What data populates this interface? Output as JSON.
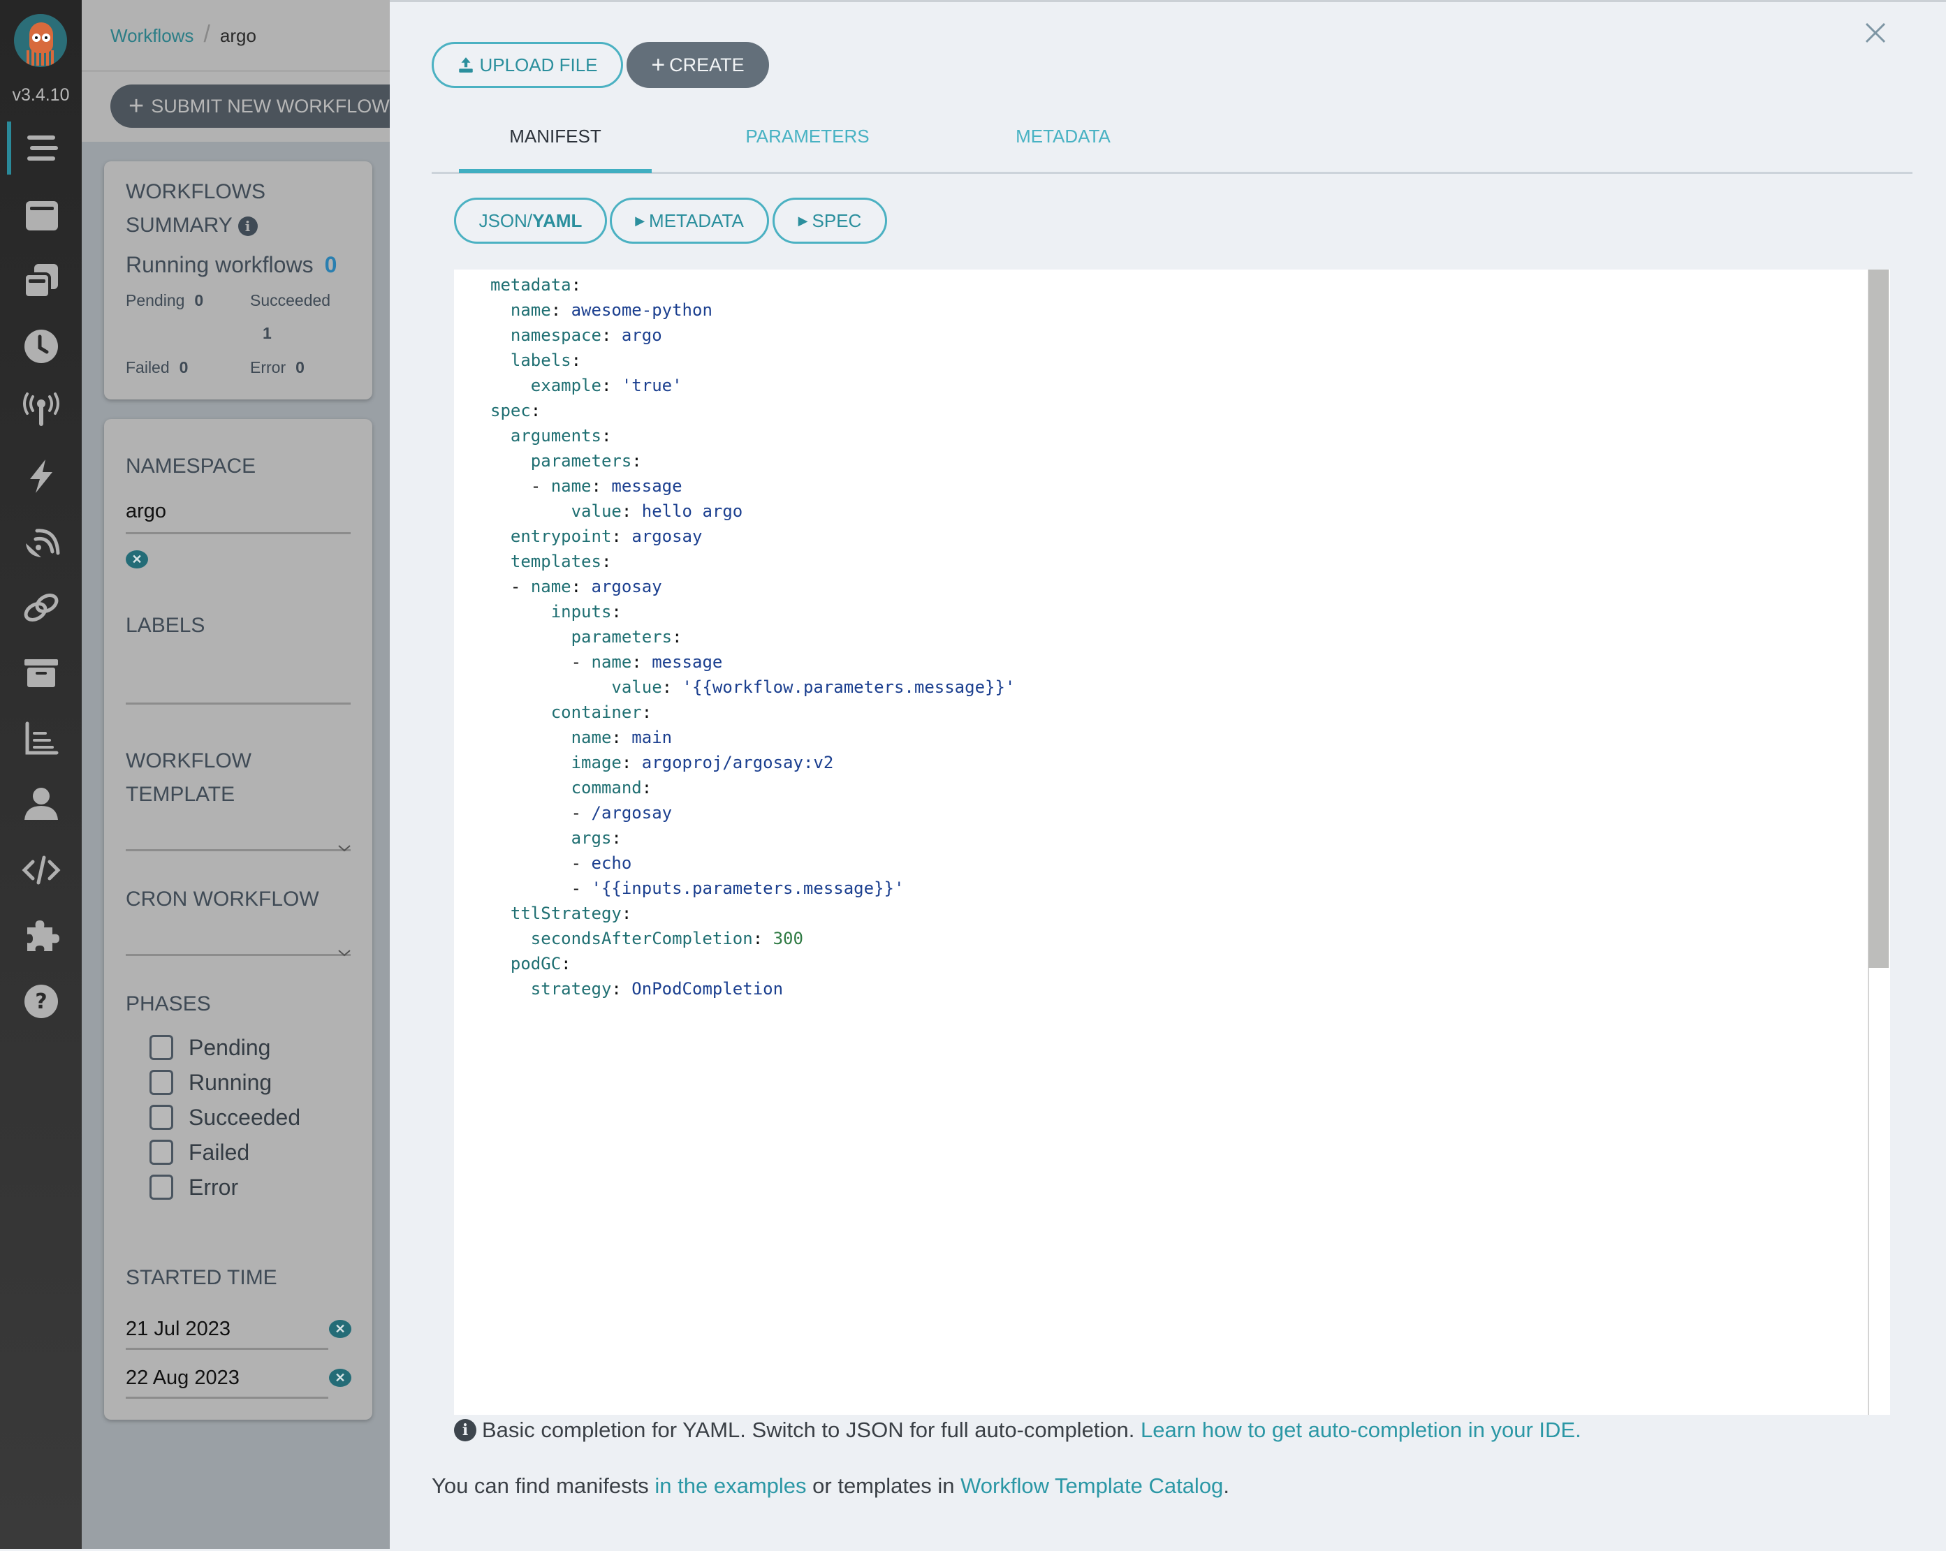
{
  "nav": {
    "version": "v3.4.10",
    "items": [
      {
        "icon": "menu-icon",
        "active": true
      },
      {
        "icon": "workflow-templates-icon"
      },
      {
        "icon": "cluster-workflow-templates-icon"
      },
      {
        "icon": "cron-workflows-icon"
      },
      {
        "icon": "event-sources-icon"
      },
      {
        "icon": "sensors-icon"
      },
      {
        "icon": "event-flow-icon"
      },
      {
        "icon": "link-icon"
      },
      {
        "icon": "archived-workflows-icon"
      },
      {
        "icon": "reports-icon"
      },
      {
        "icon": "user-icon"
      },
      {
        "icon": "api-docs-icon"
      },
      {
        "icon": "plugins-icon"
      },
      {
        "icon": "help-icon"
      }
    ]
  },
  "breadcrumb": {
    "root": "Workflows",
    "separator": "/",
    "current": "argo"
  },
  "toolbar": {
    "submit_label": "SUBMIT NEW WORKFLOW"
  },
  "summary": {
    "title_line1": "WORKFLOWS",
    "title_line2": "SUMMARY",
    "running_label": "Running workflows",
    "running_count": "0",
    "pending_label": "Pending",
    "pending_count": "0",
    "succeeded_label": "Succeeded",
    "succeeded_count": "1",
    "failed_label": "Failed",
    "failed_count": "0",
    "error_label": "Error",
    "error_count": "0"
  },
  "filters": {
    "namespace_label": "NAMESPACE",
    "namespace_value": "argo",
    "labels_label": "LABELS",
    "labels_value": "",
    "workflow_template_line1": "WORKFLOW",
    "workflow_template_line2": "TEMPLATE",
    "workflow_template_value": "",
    "cron_workflow_label": "CRON WORKFLOW",
    "cron_workflow_value": "",
    "phases_label": "PHASES",
    "phases": [
      {
        "label": "Pending",
        "checked": false
      },
      {
        "label": "Running",
        "checked": false
      },
      {
        "label": "Succeeded",
        "checked": false
      },
      {
        "label": "Failed",
        "checked": false
      },
      {
        "label": "Error",
        "checked": false
      }
    ],
    "started_time_label": "STARTED TIME",
    "started_from": "21 Jul 2023",
    "started_to": "22 Aug 2023"
  },
  "panel": {
    "upload_label": "UPLOAD FILE",
    "create_label": "CREATE",
    "tabs": [
      {
        "label": "MANIFEST",
        "active": true
      },
      {
        "label": "PARAMETERS"
      },
      {
        "label": "METADATA"
      }
    ],
    "sub_buttons": {
      "format_prefix": "JSON/",
      "format_active": "YAML",
      "metadata": "METADATA",
      "spec": "SPEC"
    },
    "editor_lines": [
      {
        "indent": 0,
        "key": "metadata",
        "value": ""
      },
      {
        "indent": 1,
        "key": "name",
        "value": "awesome-python"
      },
      {
        "indent": 1,
        "key": "namespace",
        "value": "argo"
      },
      {
        "indent": 1,
        "key": "labels",
        "value": ""
      },
      {
        "indent": 2,
        "key": "example",
        "value": "'true'"
      },
      {
        "indent": 0,
        "key": "spec",
        "value": ""
      },
      {
        "indent": 1,
        "key": "arguments",
        "value": ""
      },
      {
        "indent": 2,
        "key": "parameters",
        "value": ""
      },
      {
        "indent": 3,
        "dash": true,
        "key": "name",
        "value": "message"
      },
      {
        "indent": 4,
        "key": "value",
        "value": "hello argo"
      },
      {
        "indent": 1,
        "key": "entrypoint",
        "value": "argosay"
      },
      {
        "indent": 1,
        "key": "templates",
        "value": ""
      },
      {
        "indent": 2,
        "dash": true,
        "key": "name",
        "value": "argosay"
      },
      {
        "indent": 3,
        "key": "inputs",
        "value": ""
      },
      {
        "indent": 4,
        "key": "parameters",
        "value": ""
      },
      {
        "indent": 5,
        "dash": true,
        "key": "name",
        "value": "message"
      },
      {
        "indent": 6,
        "key": "value",
        "value": "'{{workflow.parameters.message}}'"
      },
      {
        "indent": 3,
        "key": "container",
        "value": ""
      },
      {
        "indent": 4,
        "key": "name",
        "value": "main"
      },
      {
        "indent": 4,
        "key": "image",
        "value": "argoproj/argosay:v2"
      },
      {
        "indent": 4,
        "key": "command",
        "value": ""
      },
      {
        "indent": 5,
        "dash": true,
        "key": "",
        "value": "/argosay"
      },
      {
        "indent": 4,
        "key": "args",
        "value": ""
      },
      {
        "indent": 5,
        "dash": true,
        "key": "",
        "value": "echo"
      },
      {
        "indent": 5,
        "dash": true,
        "key": "",
        "value": "'{{inputs.parameters.message}}'"
      },
      {
        "indent": 1,
        "key": "ttlStrategy",
        "value": ""
      },
      {
        "indent": 2,
        "key": "secondsAfterCompletion",
        "value": "300",
        "numeric": true
      },
      {
        "indent": 1,
        "key": "podGC",
        "value": ""
      },
      {
        "indent": 2,
        "key": "strategy",
        "value": "OnPodCompletion"
      }
    ],
    "scroll_fraction_visible": 0.61,
    "hint_text": "Basic completion for YAML. Switch to JSON for full auto-completion.",
    "hint_link": "Learn how to get auto-completion in your IDE.",
    "find_prefix": "You can find manifests",
    "find_link1": "in the examples",
    "find_middle": "or templates in",
    "find_link2": "Workflow Template Catalog",
    "find_suffix": "."
  },
  "colors": {
    "accent": "#40aec1",
    "link": "#2b97a5",
    "create_button": "#636f7a",
    "running_count": "#2a7fb0"
  }
}
